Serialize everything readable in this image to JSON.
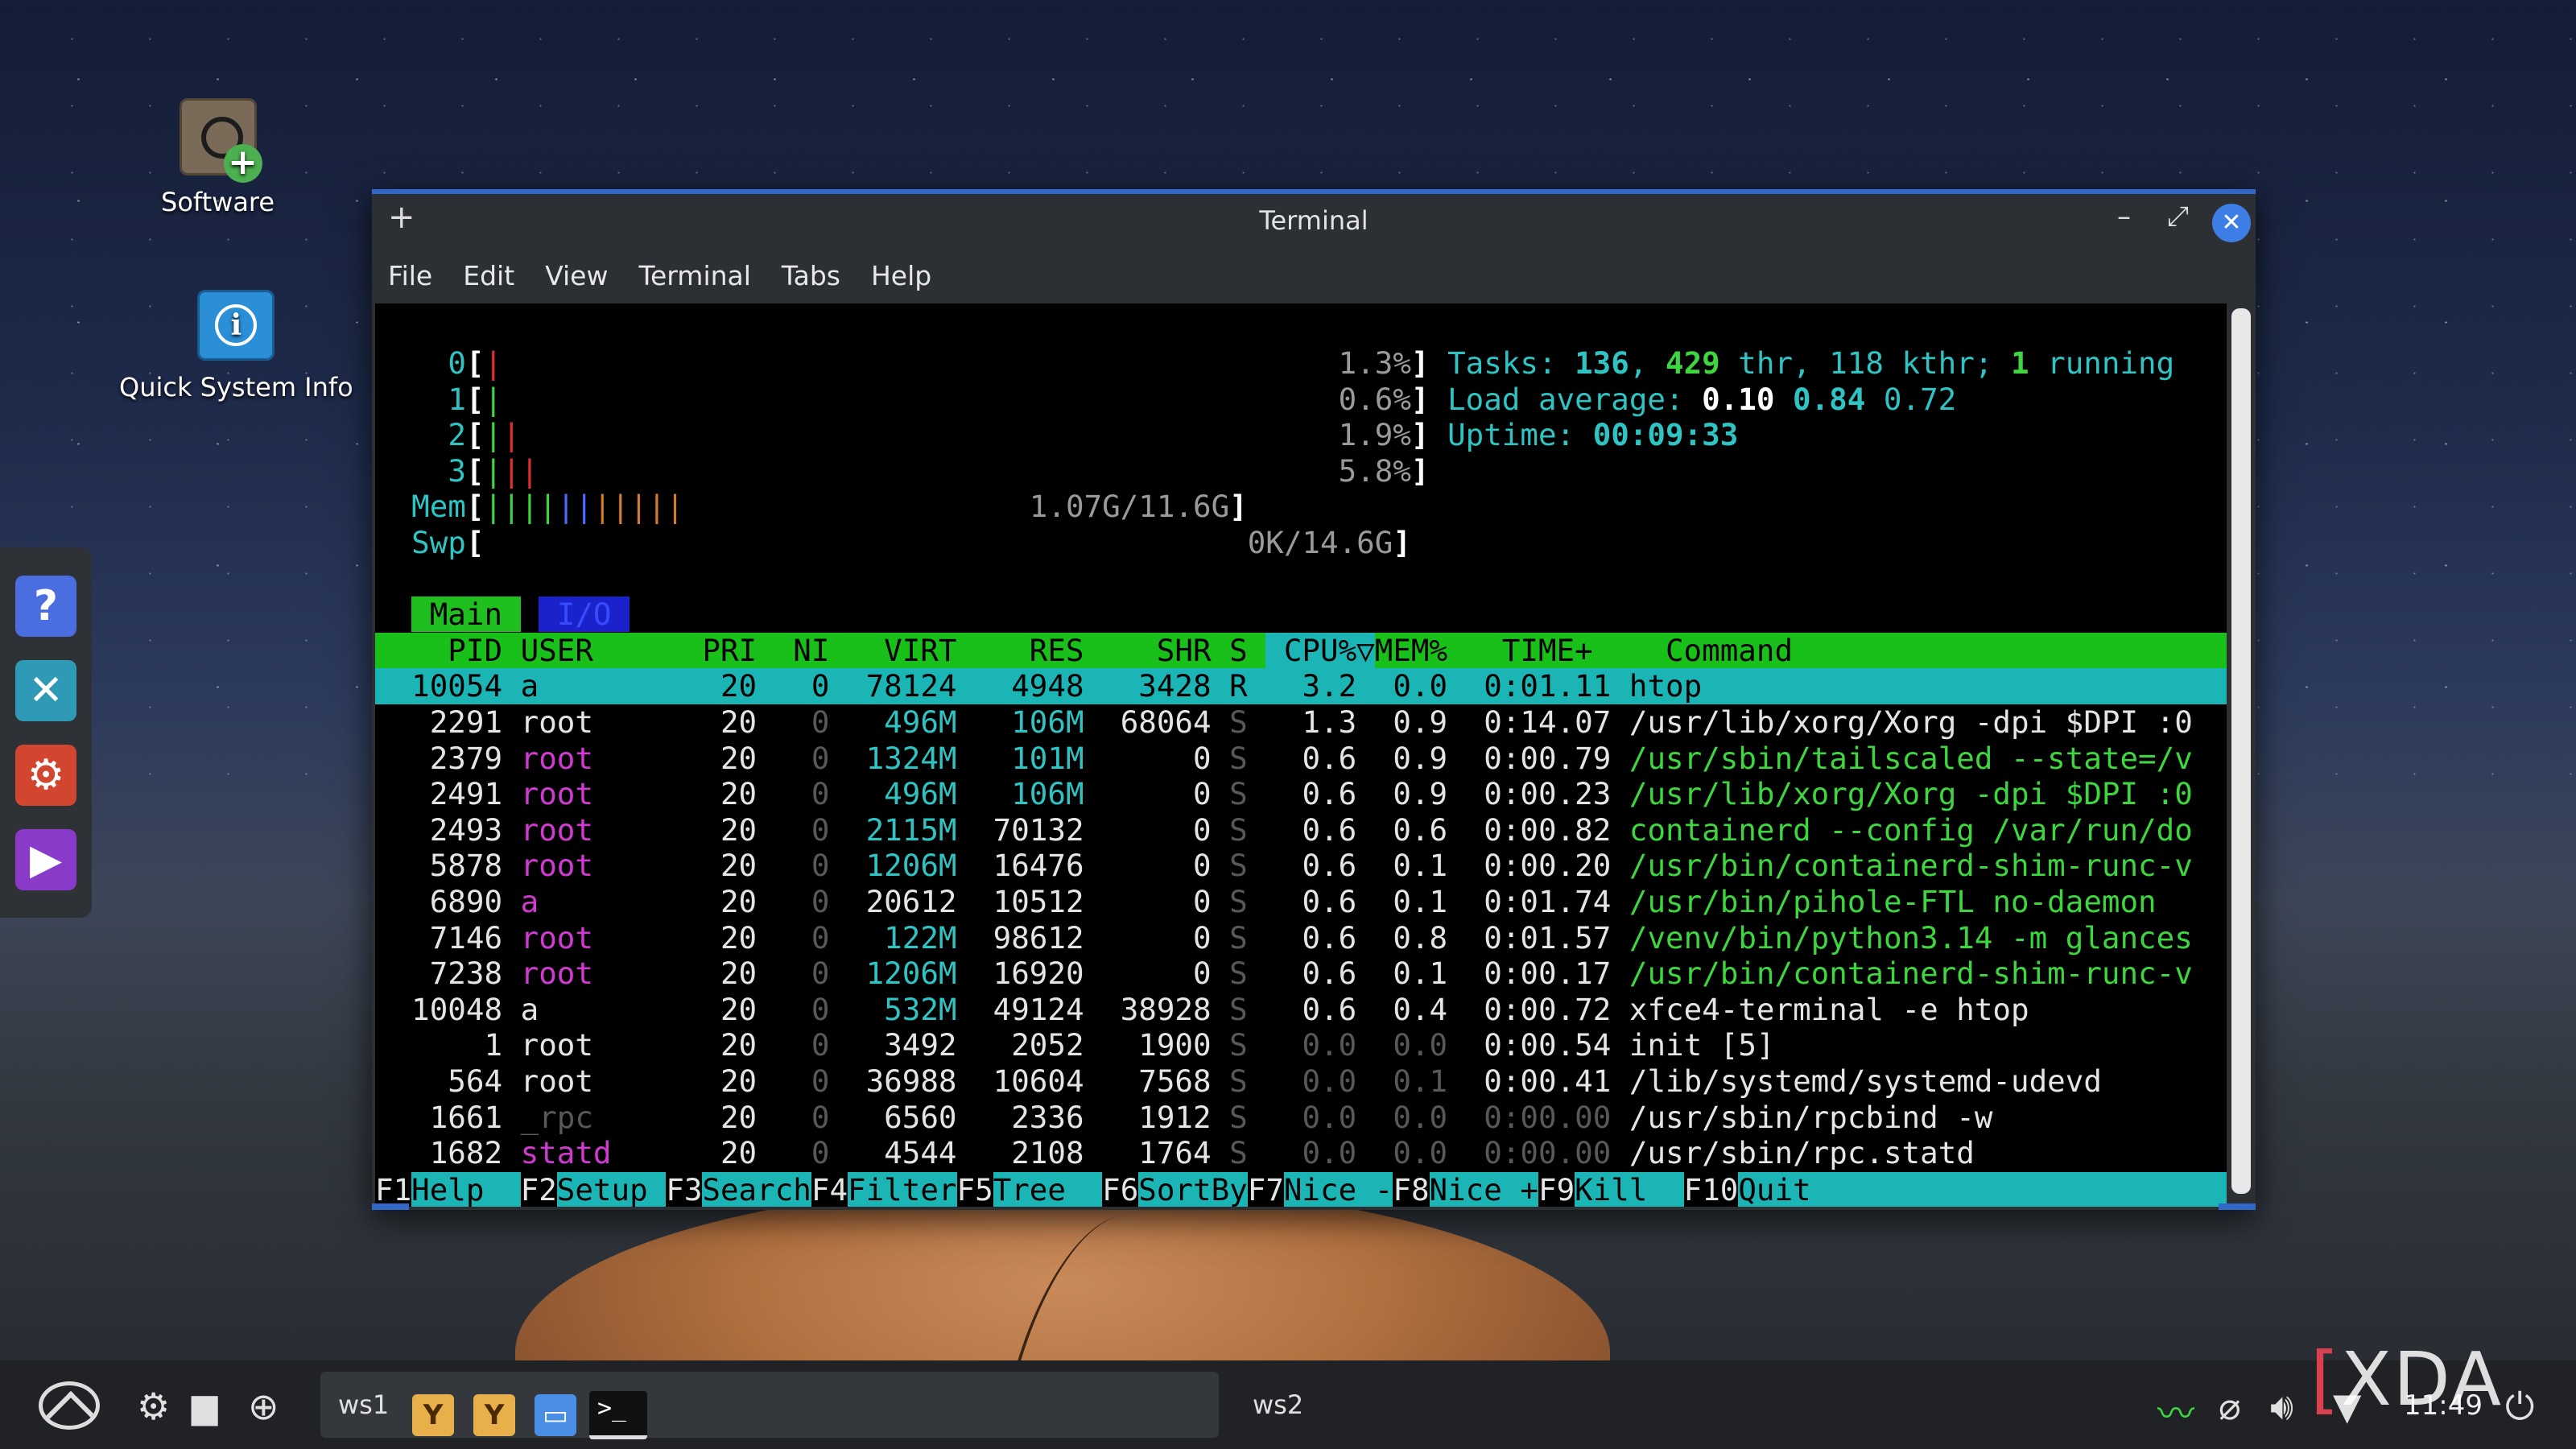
{
  "desktop": {
    "icons": [
      {
        "label": "Software"
      },
      {
        "label": "Quick System Info"
      }
    ]
  },
  "window": {
    "title": "Terminal",
    "new_tab": "+",
    "minimize": "–",
    "maximize": "⤢",
    "close": "✕",
    "menu": [
      "File",
      "Edit",
      "View",
      "Terminal",
      "Tabs",
      "Help"
    ]
  },
  "htop": {
    "cpus": [
      {
        "id": "0",
        "usage": "1.3%"
      },
      {
        "id": "1",
        "usage": "0.6%"
      },
      {
        "id": "2",
        "usage": "1.9%"
      },
      {
        "id": "3",
        "usage": "5.8%"
      }
    ],
    "mem": {
      "label": "Mem",
      "value": "1.07G/11.6G"
    },
    "swp": {
      "label": "Swp",
      "value": "0K/14.6G"
    },
    "tasks": {
      "label": "Tasks: ",
      "tasks": "136",
      "thr": "429",
      "thr_label": " thr, ",
      "kthr": "118 kthr; ",
      "running": "1",
      "running_label": " running"
    },
    "load": {
      "label": "Load average: ",
      "l1": "0.10",
      "l5": "0.84",
      "l15": "0.72"
    },
    "uptime": {
      "label": "Uptime: ",
      "value": "00:09:33"
    },
    "tabs": [
      "Main",
      "I/O"
    ],
    "columns": {
      "pid": "PID",
      "user": "USER",
      "pri": "PRI",
      "ni": "NI",
      "virt": "VIRT",
      "res": "RES",
      "shr": "SHR",
      "s": "S",
      "cpu": "CPU%▽",
      "mem": "MEM%",
      "time": "TIME+",
      "command": "Command"
    },
    "processes": [
      {
        "pid": "10054",
        "user": "a",
        "pri": "20",
        "ni": "0",
        "virt": "78124",
        "res": "4948",
        "shr": "3428",
        "s": "R",
        "cpu": "3.2",
        "mem": "0.0",
        "time": "0:01.11",
        "cmd": "htop"
      },
      {
        "pid": "2291",
        "user": "root",
        "pri": "20",
        "ni": "0",
        "virt": "496M",
        "res": "106M",
        "shr": "68064",
        "s": "S",
        "cpu": "1.3",
        "mem": "0.9",
        "time": "0:14.07",
        "cmd": "/usr/lib/xorg/Xorg -dpi $DPI :0"
      },
      {
        "pid": "2379",
        "user": "root",
        "pri": "20",
        "ni": "0",
        "virt": "1324M",
        "res": "101M",
        "shr": "0",
        "s": "S",
        "cpu": "0.6",
        "mem": "0.9",
        "time": "0:00.79",
        "cmd": "/usr/sbin/tailscaled --state=/v"
      },
      {
        "pid": "2491",
        "user": "root",
        "pri": "20",
        "ni": "0",
        "virt": "496M",
        "res": "106M",
        "shr": "0",
        "s": "S",
        "cpu": "0.6",
        "mem": "0.9",
        "time": "0:00.23",
        "cmd": "/usr/lib/xorg/Xorg -dpi $DPI :0"
      },
      {
        "pid": "2493",
        "user": "root",
        "pri": "20",
        "ni": "0",
        "virt": "2115M",
        "res": "70132",
        "shr": "0",
        "s": "S",
        "cpu": "0.6",
        "mem": "0.6",
        "time": "0:00.82",
        "cmd": "containerd --config /var/run/do"
      },
      {
        "pid": "5878",
        "user": "root",
        "pri": "20",
        "ni": "0",
        "virt": "1206M",
        "res": "16476",
        "shr": "0",
        "s": "S",
        "cpu": "0.6",
        "mem": "0.1",
        "time": "0:00.20",
        "cmd": "/usr/bin/containerd-shim-runc-v"
      },
      {
        "pid": "6890",
        "user": "a",
        "pri": "20",
        "ni": "0",
        "virt": "20612",
        "res": "10512",
        "shr": "0",
        "s": "S",
        "cpu": "0.6",
        "mem": "0.1",
        "time": "0:01.74",
        "cmd": "/usr/bin/pihole-FTL no-daemon"
      },
      {
        "pid": "7146",
        "user": "root",
        "pri": "20",
        "ni": "0",
        "virt": "122M",
        "res": "98612",
        "shr": "0",
        "s": "S",
        "cpu": "0.6",
        "mem": "0.8",
        "time": "0:01.57",
        "cmd": "/venv/bin/python3.14 -m glances"
      },
      {
        "pid": "7238",
        "user": "root",
        "pri": "20",
        "ni": "0",
        "virt": "1206M",
        "res": "16920",
        "shr": "0",
        "s": "S",
        "cpu": "0.6",
        "mem": "0.1",
        "time": "0:00.17",
        "cmd": "/usr/bin/containerd-shim-runc-v"
      },
      {
        "pid": "10048",
        "user": "a",
        "pri": "20",
        "ni": "0",
        "virt": "532M",
        "res": "49124",
        "shr": "38928",
        "s": "S",
        "cpu": "0.6",
        "mem": "0.4",
        "time": "0:00.72",
        "cmd": "xfce4-terminal -e htop"
      },
      {
        "pid": "1",
        "user": "root",
        "pri": "20",
        "ni": "0",
        "virt": "3492",
        "res": "2052",
        "shr": "1900",
        "s": "S",
        "cpu": "0.0",
        "mem": "0.0",
        "time": "0:00.54",
        "cmd": "init [5]"
      },
      {
        "pid": "564",
        "user": "root",
        "pri": "20",
        "ni": "0",
        "virt": "36988",
        "res": "10604",
        "shr": "7568",
        "s": "S",
        "cpu": "0.0",
        "mem": "0.1",
        "time": "0:00.41",
        "cmd": "/lib/systemd/systemd-udevd"
      },
      {
        "pid": "1661",
        "user": "_rpc",
        "pri": "20",
        "ni": "0",
        "virt": "6560",
        "res": "2336",
        "shr": "1912",
        "s": "S",
        "cpu": "0.0",
        "mem": "0.0",
        "time": "0:00.00",
        "cmd": "/usr/sbin/rpcbind -w"
      },
      {
        "pid": "1682",
        "user": "statd",
        "pri": "20",
        "ni": "0",
        "virt": "4544",
        "res": "2108",
        "shr": "1764",
        "s": "S",
        "cpu": "0.0",
        "mem": "0.0",
        "time": "0:00.00",
        "cmd": "/usr/sbin/rpc.statd"
      }
    ],
    "fkeys": [
      {
        "key": "F1",
        "label": "Help  "
      },
      {
        "key": "F2",
        "label": "Setup "
      },
      {
        "key": "F3",
        "label": "Search"
      },
      {
        "key": "F4",
        "label": "Filter"
      },
      {
        "key": "F5",
        "label": "Tree  "
      },
      {
        "key": "F6",
        "label": "SortBy"
      },
      {
        "key": "F7",
        "label": "Nice -"
      },
      {
        "key": "F8",
        "label": "Nice +"
      },
      {
        "key": "F9",
        "label": "Kill  "
      },
      {
        "key": "F10",
        "label": "Quit"
      }
    ]
  },
  "taskbar": {
    "workspace1": "ws1",
    "workspace2": "ws2",
    "clock": "11:49",
    "terminal_glyph": ">_"
  },
  "watermark": "XDA",
  "colors": {
    "accent": "#2f68c9",
    "htop_green": "#19c019",
    "htop_cyan": "#1bb5b5"
  }
}
